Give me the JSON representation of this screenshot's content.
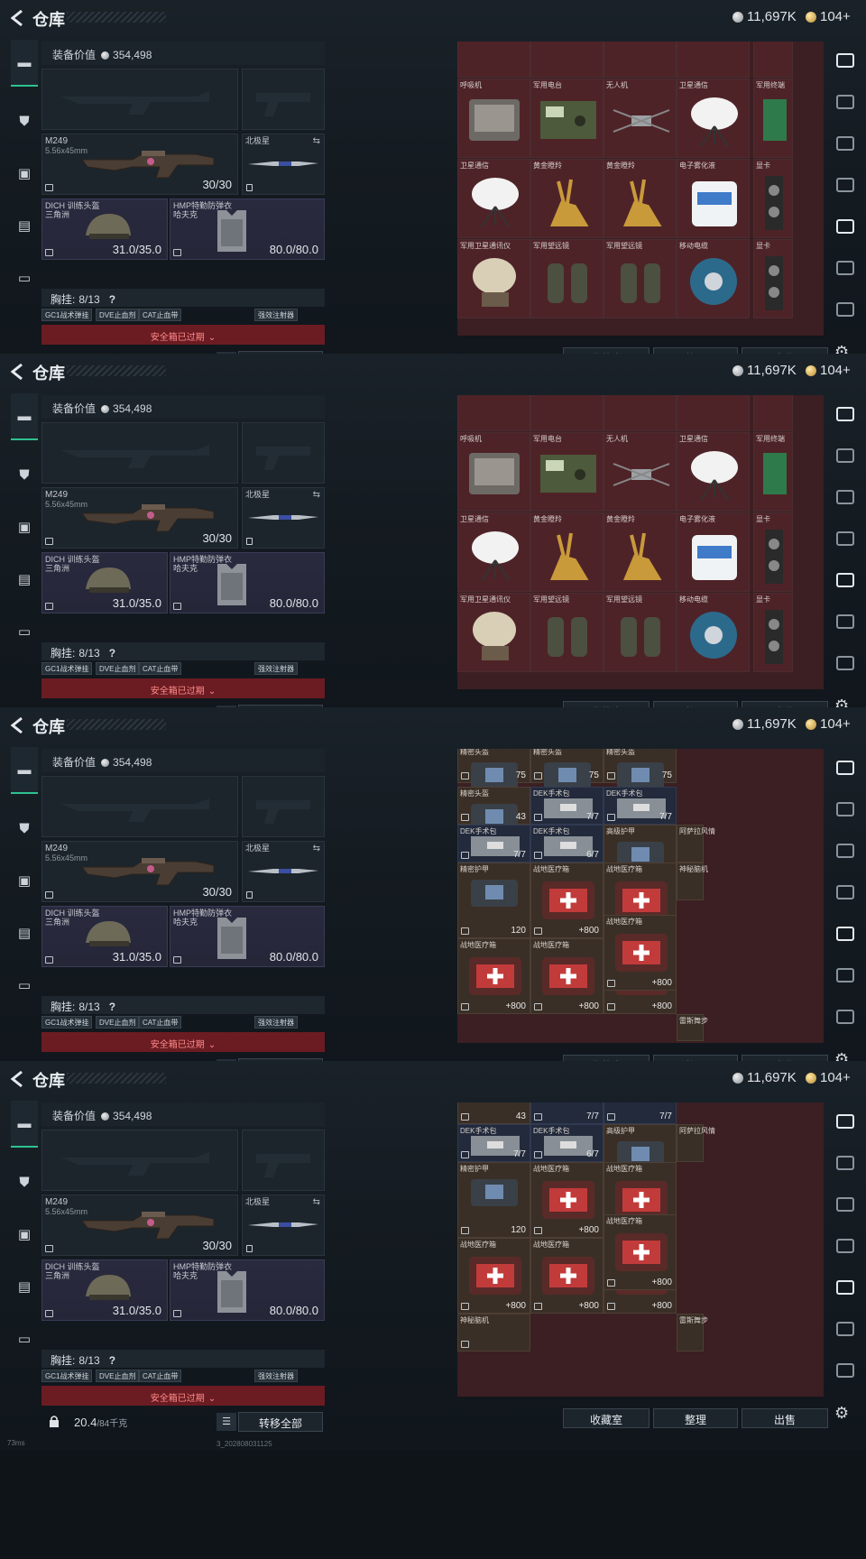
{
  "header": {
    "title": "仓库",
    "silver": "11,697K",
    "gold": "104+"
  },
  "loadout": {
    "value_label": "装备价值",
    "value": "354,498",
    "weapon": {
      "name": "M249",
      "caliber": "5.56x45mm",
      "ammo": "30/30"
    },
    "knife": {
      "name": "北极星"
    },
    "helmet": {
      "name": "DICH 训练头盔",
      "sub": "三角洲",
      "durability": "31.0/35.0"
    },
    "armor": {
      "name": "HMP特勤防弹衣",
      "sub": "哈夫克",
      "durability": "80.0/80.0"
    },
    "chest": {
      "label": "胸挂:",
      "value": "8/13",
      "help": "?"
    },
    "chest_items": [
      "GC1战术弹挂",
      "DVE止血剂",
      "CAT止血带",
      "强效注射器"
    ],
    "safe_box": "安全箱已过期",
    "weight": "20.4",
    "weight_unit": "/84千克",
    "transfer": "转移全部"
  },
  "buttons": {
    "favorites": "收藏室",
    "sort": "整理",
    "sell": "出售"
  },
  "status": {
    "ping": "73ms",
    "build": "3_202808031125"
  },
  "frames": [
    {
      "rows": [
        [
          {
            "n": "",
            "cls": "",
            "w": 1
          },
          {
            "n": "",
            "cls": "",
            "w": 1
          },
          {
            "n": "",
            "cls": "",
            "w": 1
          },
          {
            "n": "",
            "cls": "",
            "w": 1
          },
          {
            "n": "",
            "cls": "",
            "w": 0.5
          }
        ],
        [
          {
            "n": "呼吸机",
            "w": 1
          },
          {
            "n": "军用电台",
            "w": 1
          },
          {
            "n": "无人机",
            "w": 1
          },
          {
            "n": "卫星通信",
            "w": 1
          },
          {
            "n": "军用终端",
            "w": 0.5
          }
        ],
        [
          {
            "n": "卫星通信",
            "w": 1
          },
          {
            "n": "黄金瞪羚",
            "w": 1
          },
          {
            "n": "黄金瞪羚",
            "w": 1
          },
          {
            "n": "电子雾化液",
            "w": 1
          },
          {
            "n": "显卡",
            "w": 0.5
          }
        ],
        [
          {
            "n": "军用卫星通讯仪",
            "w": 1
          },
          {
            "n": "军用望远镜",
            "w": 1
          },
          {
            "n": "军用望远镜",
            "w": 1
          },
          {
            "n": "移动电缆",
            "w": 1
          },
          {
            "n": "显卡",
            "w": 0.5
          }
        ]
      ]
    },
    {
      "rows": [
        [
          {
            "n": "",
            "w": 1
          },
          {
            "n": "",
            "w": 1
          },
          {
            "n": "",
            "w": 1
          },
          {
            "n": "",
            "w": 1
          },
          {
            "n": "",
            "w": 0.5
          }
        ],
        [
          {
            "n": "呼吸机",
            "w": 1
          },
          {
            "n": "军用电台",
            "w": 1
          },
          {
            "n": "无人机",
            "w": 1
          },
          {
            "n": "卫星通信",
            "w": 1
          },
          {
            "n": "军用终端",
            "w": 0.5
          }
        ],
        [
          {
            "n": "卫星通信",
            "w": 1
          },
          {
            "n": "黄金瞪羚",
            "w": 1
          },
          {
            "n": "黄金瞪羚",
            "w": 1
          },
          {
            "n": "电子雾化液",
            "w": 1
          },
          {
            "n": "显卡",
            "w": 0.5
          }
        ],
        [
          {
            "n": "军用卫星通讯仪",
            "w": 1
          },
          {
            "n": "军用望远镜",
            "w": 1
          },
          {
            "n": "军用望远镜",
            "w": 1
          },
          {
            "n": "移动电缆",
            "w": 1
          },
          {
            "n": "显卡",
            "w": 0.5
          }
        ]
      ]
    },
    {
      "medical": true,
      "cells": [
        {
          "n": "精密头盔",
          "v": "75"
        },
        {
          "n": "精密头盔",
          "v": "75"
        },
        {
          "n": "精密头盔",
          "v": "75"
        },
        {
          "n": "精密头盔",
          "v": "43"
        },
        {
          "n": "DEK手术包",
          "v": "7/7"
        },
        {
          "n": "DEK手术包",
          "v": "7/7"
        },
        {
          "n": "DEK手术包",
          "v": "7/7"
        },
        {
          "n": "DEK手术包",
          "v": "6/7"
        },
        {
          "n": "高级护甲",
          "v": "200"
        },
        {
          "n": "精密护甲",
          "v": "120"
        },
        {
          "n": "战地医疗箱",
          "v": "+800"
        },
        {
          "n": "战地医疗箱",
          "v": "+800"
        },
        {
          "n": "战地医疗箱",
          "v": "+800"
        },
        {
          "n": "战地医疗箱",
          "v": "+800"
        },
        {
          "n": "战地医疗箱",
          "v": "+800"
        },
        {
          "n": "战地医疗箱",
          "v": "+800"
        },
        {
          "n": "阿萨拉风情",
          "v": ""
        },
        {
          "n": "神秘脑机",
          "v": ""
        },
        {
          "n": "雷斯舞步",
          "v": ""
        }
      ]
    },
    {
      "medical": true,
      "cells": [
        {
          "n": "",
          "v": "43"
        },
        {
          "n": "",
          "v": "7/7"
        },
        {
          "n": "",
          "v": "7/7"
        },
        {
          "n": "DEK手术包",
          "v": "7/7"
        },
        {
          "n": "DEK手术包",
          "v": "6/7"
        },
        {
          "n": "高级护甲",
          "v": "200"
        },
        {
          "n": "精密护甲",
          "v": "120"
        },
        {
          "n": "战地医疗箱",
          "v": "+800"
        },
        {
          "n": "战地医疗箱",
          "v": "+800"
        },
        {
          "n": "战地医疗箱",
          "v": "+800"
        },
        {
          "n": "战地医疗箱",
          "v": "+800"
        },
        {
          "n": "战地医疗箱",
          "v": "+800"
        },
        {
          "n": "战地医疗箱",
          "v": "+800"
        },
        {
          "n": "神秘脑机",
          "v": ""
        },
        {
          "n": "阿萨拉风情",
          "v": ""
        },
        {
          "n": "雷斯舞步",
          "v": ""
        }
      ]
    }
  ]
}
